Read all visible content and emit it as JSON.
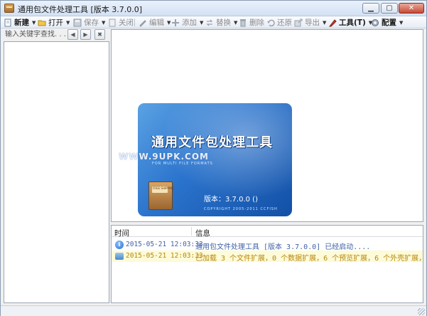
{
  "window": {
    "title": "通用包文件处理工具 [版本 3.7.0.0]",
    "min_label": "▁",
    "max_label": "▢",
    "close_label": "✕"
  },
  "toolbar": {
    "new_label": "新建",
    "open_label": "打开",
    "save_label": "保存",
    "close_label": "关闭",
    "edit_label": "编辑",
    "add_label": "添加",
    "replace_label": "替换",
    "delete_label": "删除",
    "restore_label": "还原",
    "export_label": "导出",
    "tools_label": "工具(T)",
    "config_label": "配置"
  },
  "search": {
    "placeholder": "输入关键字查找. . . ."
  },
  "splash": {
    "title": "通用文件包处理工具",
    "subtitle": "FOR MULTI FILE FORMATS",
    "version": "版本：3.7.0.0 ()",
    "copyright": "COPYRIGHT 2005-2011 CCFISH",
    "watermark": "WWW.9UPK.COM",
    "box_label": "FREE SHIPPING"
  },
  "log": {
    "col_time": "时间",
    "col_info": "信息",
    "rows": [
      {
        "icon": "info-icon",
        "time": "2015-05-21 12:03:33",
        "text": "通用包文件处理工具 [版本 3.7.0.0] 已经启动...."
      },
      {
        "icon": "message-icon",
        "time": "2015-05-21 12:03:33",
        "text": "已加载 3 个文件扩展，0 个数据扩展，6 个预览扩展，6 个外壳扩展，1 个..."
      }
    ]
  },
  "colors": {
    "accent": "#2a73cc",
    "info_text": "#4062a8",
    "warn_text": "#b8860b",
    "highlight_row": "#fdfbd8"
  }
}
